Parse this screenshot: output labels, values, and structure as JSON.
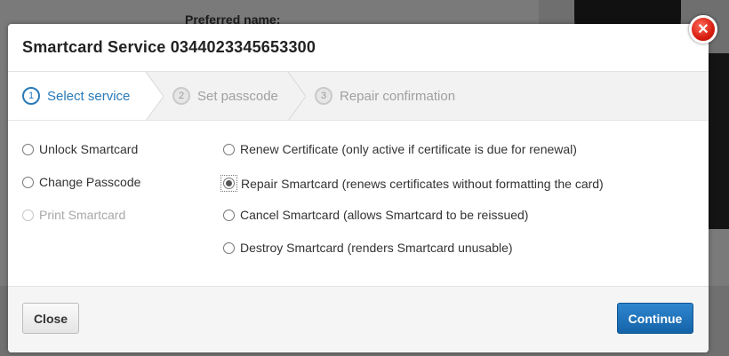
{
  "background": {
    "preferred_name_label": "Preferred name:"
  },
  "dialog": {
    "title": "Smartcard Service 0344023345653300",
    "close_icon": "close-x-icon"
  },
  "steps": [
    {
      "number": "1",
      "label": "Select service",
      "active": true
    },
    {
      "number": "2",
      "label": "Set passcode",
      "active": false
    },
    {
      "number": "3",
      "label": "Repair confirmation",
      "active": false
    }
  ],
  "options": {
    "left": [
      {
        "label": "Unlock Smartcard",
        "checked": false,
        "disabled": false
      },
      {
        "label": "Change Passcode",
        "checked": false,
        "disabled": false
      },
      {
        "label": "Print Smartcard",
        "checked": false,
        "disabled": true
      }
    ],
    "right": [
      {
        "label": "Renew Certificate",
        "note": "(only active if certificate is due for renewal)",
        "checked": false
      },
      {
        "label": "Repair Smartcard",
        "note": "(renews certificates without formatting the card)",
        "checked": true
      },
      {
        "label": "Cancel Smartcard",
        "note": "(allows Smartcard to be reissued)",
        "checked": false
      },
      {
        "label": "Destroy Smartcard",
        "note": "(renders Smartcard unusable)",
        "checked": false
      }
    ]
  },
  "footer": {
    "close_label": "Close",
    "continue_label": "Continue"
  },
  "colors": {
    "accent": "#2a7ab8",
    "primary_button": "#1a6fb8",
    "close_icon": "#d81e10"
  }
}
